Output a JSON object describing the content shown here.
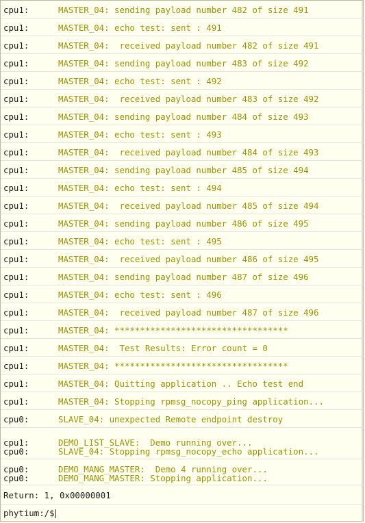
{
  "log": [
    {
      "src": "cpu1:",
      "msg": "MASTER_04: sending payload number 482 of size 491"
    },
    {
      "src": "cpu1:",
      "msg": "MASTER_04: echo test: sent : 491"
    },
    {
      "src": "cpu1:",
      "msg": "MASTER_04:  received payload number 482 of size 491"
    },
    {
      "src": "cpu1:",
      "msg": "MASTER_04: sending payload number 483 of size 492"
    },
    {
      "src": "cpu1:",
      "msg": "MASTER_04: echo test: sent : 492"
    },
    {
      "src": "cpu1:",
      "msg": "MASTER_04:  received payload number 483 of size 492"
    },
    {
      "src": "cpu1:",
      "msg": "MASTER_04: sending payload number 484 of size 493"
    },
    {
      "src": "cpu1:",
      "msg": "MASTER_04: echo test: sent : 493"
    },
    {
      "src": "cpu1:",
      "msg": "MASTER_04:  received payload number 484 of size 493"
    },
    {
      "src": "cpu1:",
      "msg": "MASTER_04: sending payload number 485 of size 494"
    },
    {
      "src": "cpu1:",
      "msg": "MASTER_04: echo test: sent : 494"
    },
    {
      "src": "cpu1:",
      "msg": "MASTER_04:  received payload number 485 of size 494"
    },
    {
      "src": "cpu1:",
      "msg": "MASTER_04: sending payload number 486 of size 495"
    },
    {
      "src": "cpu1:",
      "msg": "MASTER_04: echo test: sent : 495"
    },
    {
      "src": "cpu1:",
      "msg": "MASTER_04:  received payload number 486 of size 495"
    },
    {
      "src": "cpu1:",
      "msg": "MASTER_04: sending payload number 487 of size 496"
    },
    {
      "src": "cpu1:",
      "msg": "MASTER_04: echo test: sent : 496"
    },
    {
      "src": "cpu1:",
      "msg": "MASTER_04:  received payload number 487 of size 496"
    },
    {
      "src": "cpu1:",
      "msg": "MASTER_04: **********************************"
    },
    {
      "src": "cpu1:",
      "msg": "MASTER_04:  Test Results: Error count = 0"
    },
    {
      "src": "cpu1:",
      "msg": "MASTER_04: **********************************"
    },
    {
      "src": "cpu1:",
      "msg": "MASTER_04: Quitting application .. Echo test end"
    },
    {
      "src": "cpu1:",
      "msg": "MASTER_04: Stopping rpmsg_nocopy_ping application..."
    },
    {
      "src": "cpu0:",
      "msg": "SLAVE_04: unexpected Remote endpoint destroy"
    }
  ],
  "block1": [
    {
      "src": "cpu1:",
      "msg": "DEMO_LIST_SLAVE:  Demo running over..."
    },
    {
      "src": "cpu0:",
      "msg": "SLAVE_04: Stopping rpmsg_nocopy_echo application..."
    }
  ],
  "block2": [
    {
      "src": "cpu0:",
      "msg": "DEMO_MANG_MASTER:  Demo 4 running over..."
    },
    {
      "src": "cpu0:",
      "msg": "DEMO_MANG_MASTER: Stopping application..."
    }
  ],
  "return_line": "Return: 1, 0x00000001",
  "prompt": "phytium:/$",
  "colors": {
    "background": "#fffff0",
    "message": "#9a9200",
    "source": "#1b1b1b"
  }
}
